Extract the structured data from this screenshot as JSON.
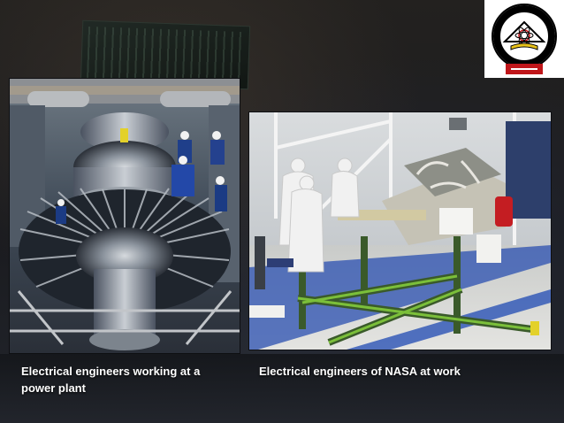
{
  "slide": {
    "background_color": "#1b1c20",
    "caption_color": "#ffffff"
  },
  "logo": {
    "icon": "university-seal-icon",
    "colors": [
      "#000000",
      "#ffffff",
      "#c0161a",
      "#e8c21a"
    ]
  },
  "photos": [
    {
      "name": "power-plant-photo",
      "icon": "steam-turbine-image",
      "caption": "Electrical engineers working at a power plant"
    },
    {
      "name": "nasa-lab-photo",
      "icon": "cleanroom-satellite-image",
      "caption": "Electrical engineers of NASA at work"
    }
  ]
}
